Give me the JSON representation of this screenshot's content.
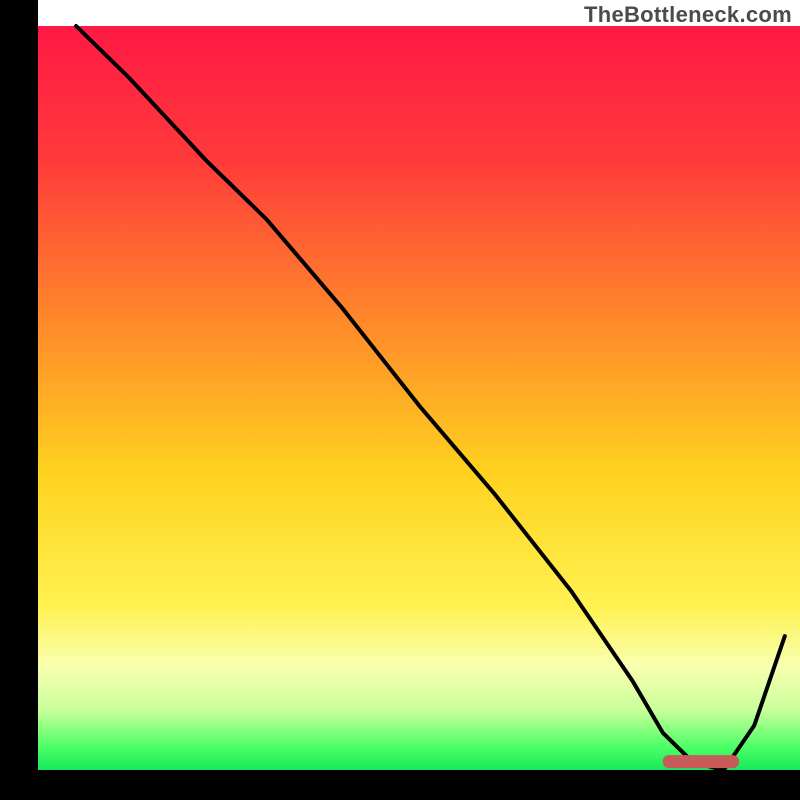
{
  "watermark": "TheBottleneck.com",
  "chart_data": {
    "type": "line",
    "title": "",
    "xlabel": "",
    "ylabel": "",
    "xlim": [
      0,
      100
    ],
    "ylim": [
      0,
      100
    ],
    "x": [
      5,
      12,
      22,
      30,
      40,
      50,
      60,
      70,
      78,
      82,
      86,
      90,
      94,
      98
    ],
    "values": [
      100,
      93,
      82,
      74,
      62,
      49,
      37,
      24,
      12,
      5,
      1,
      0,
      6,
      18
    ],
    "optimal_band": {
      "x_start": 82,
      "x_end": 92,
      "y": 1.2
    },
    "gradient_stops": [
      {
        "offset": 0,
        "color": "#ff1944"
      },
      {
        "offset": 18,
        "color": "#ff3a3a"
      },
      {
        "offset": 40,
        "color": "#ff8a2a"
      },
      {
        "offset": 60,
        "color": "#ffd21f"
      },
      {
        "offset": 78,
        "color": "#fff250"
      },
      {
        "offset": 86,
        "color": "#f9ffb0"
      },
      {
        "offset": 92,
        "color": "#c9ff9a"
      },
      {
        "offset": 97,
        "color": "#4aff66"
      },
      {
        "offset": 100,
        "color": "#18e85a"
      }
    ],
    "axis_color": "#000000",
    "curve_color": "#000000",
    "optimal_band_color": "#c95a5a"
  }
}
